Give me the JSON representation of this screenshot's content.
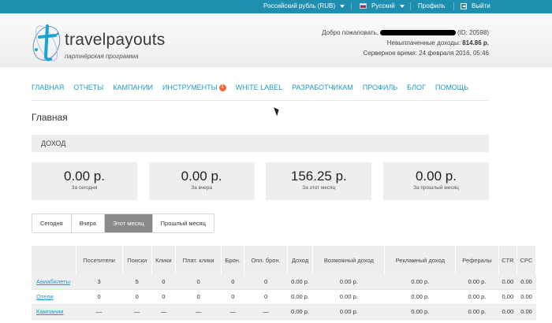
{
  "topbar": {
    "currency": "Российский рубль (RUB)",
    "language": "Русский",
    "profile": "Профиль",
    "logout": "Выйти"
  },
  "header": {
    "logo_text": "travelpayouts",
    "logo_subtitle": "партнёрская программа",
    "welcome_prefix": "Добро пожаловать,",
    "welcome_id": "(ID: 20598)",
    "unpaid_label": "Невыплаченные доходы:",
    "unpaid_value": "814.86 р.",
    "server_time_label": "Серверное время:",
    "server_time_value": "24 февраля 2016, 05:46"
  },
  "nav": {
    "items": [
      "ГЛАВНАЯ",
      "ОТЧЕТЫ",
      "КАМПАНИИ",
      "ИНСТРУМЕНТЫ",
      "WHITE LABEL",
      "РАЗРАБОТЧИКАМ",
      "ПРОФИЛЬ",
      "БЛОГ",
      "ПОМОЩЬ"
    ],
    "tools_badge": "1"
  },
  "page": {
    "title": "Главная",
    "section": "ДОХОД"
  },
  "stats": [
    {
      "value": "0.00 р.",
      "label": "За сегодня"
    },
    {
      "value": "0.00 р.",
      "label": "За вчера"
    },
    {
      "value": "156.25 р.",
      "label": "За этот месяц"
    },
    {
      "value": "0.00 р.",
      "label": "За прошлый месяц"
    }
  ],
  "tabs": [
    "Сегодня",
    "Вчера",
    "Этот месяц",
    "Прошлый месяц"
  ],
  "active_tab": 2,
  "table": {
    "headers": [
      "",
      "Посетители",
      "Поиски",
      "Клики",
      "Плат. клики",
      "Брон.",
      "Опл. брон.",
      "Доход",
      "Возможный доход",
      "Рекламный доход",
      "Рефералы",
      "CTR",
      "CPC"
    ],
    "rows": [
      [
        "Авиабилеты",
        "3",
        "5",
        "0",
        "0",
        "0",
        "0",
        "0.00 р.",
        "0.00 р.",
        "0.00 р.",
        "0.00 р.",
        "0.00",
        "0.00"
      ],
      [
        "Отели",
        "0",
        "0",
        "0",
        "0",
        "0",
        "0",
        "0.00 р.",
        "0.00 р.",
        "0.00 р.",
        "0.00 р.",
        "0.00",
        "0.00"
      ],
      [
        "Кампании",
        "—",
        "—",
        "—",
        "—",
        "—",
        "—",
        "0.00 р.",
        "0.00 р.",
        "0.00 р.",
        "0.00 р.",
        "0.00",
        "0.00"
      ]
    ]
  },
  "colors": {
    "topbar": "#1f8fb1",
    "link": "#1f9ac7",
    "badge": "#f26a3a",
    "active_tab": "#8a8a8a"
  }
}
